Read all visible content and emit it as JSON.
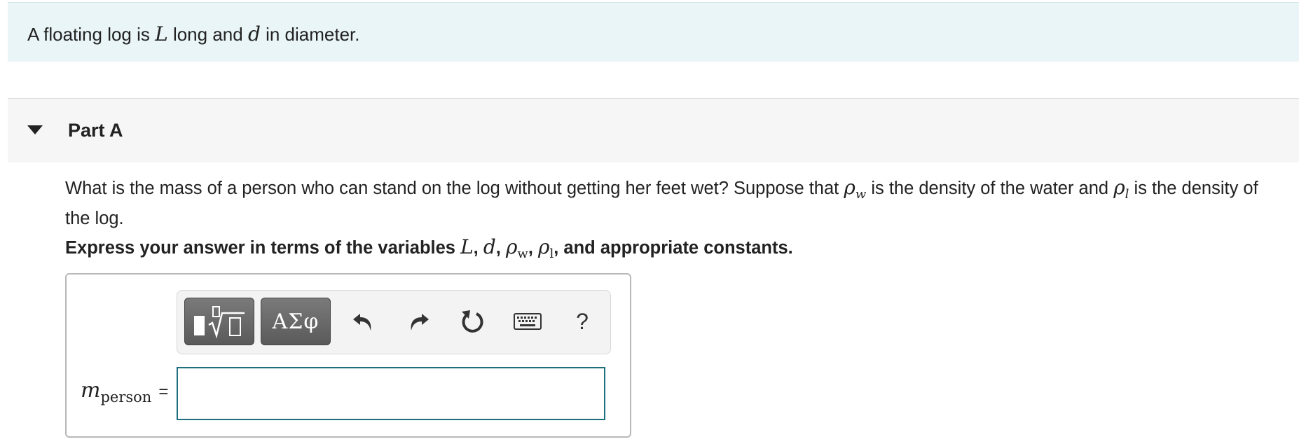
{
  "intro": {
    "text_prefix": "A floating log is ",
    "var_L": "L",
    "text_mid": " long and ",
    "var_d": "d",
    "text_suffix": " in diameter."
  },
  "part": {
    "title": "Part A",
    "question_line1_a": "What is the mass of a person who can stand on the log without getting her feet wet? Suppose that ",
    "rho_w_base": "ρ",
    "rho_w_sub": "w",
    "question_line1_b": " is the density of the water and ",
    "rho_l_base": "ρ",
    "rho_l_sub": "l",
    "question_line1_c": " is the density of",
    "question_line2": "the log.",
    "instruction_prefix": "Express your answer in terms of the variables ",
    "instruction_vars": {
      "L": "L",
      "sep1": ", ",
      "d": "d",
      "sep2": ", ",
      "rho_w_base": "ρ",
      "rho_w_sub": "w",
      "sep3": ", ",
      "rho_l_base": "ρ",
      "rho_l_sub": "l"
    },
    "instruction_suffix": ", and appropriate constants."
  },
  "toolbar": {
    "templates_icon": "templates-icon",
    "greek_label": "ΑΣφ",
    "undo_icon": "undo-icon",
    "redo_icon": "redo-icon",
    "reset_icon": "reset-icon",
    "keyboard_icon": "keyboard-icon",
    "help_label": "?"
  },
  "answer": {
    "label_var": "m",
    "label_sub": "person",
    "equals": "=",
    "value": ""
  }
}
